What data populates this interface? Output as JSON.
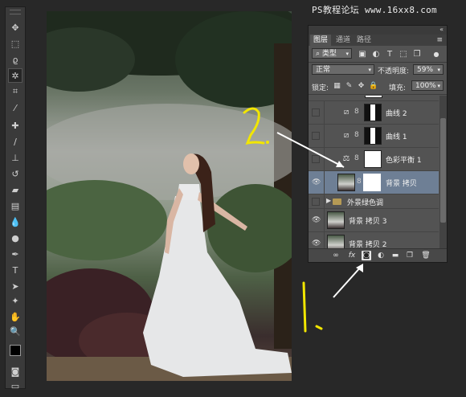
{
  "watermark": "PS教程论坛 www.16xx8.com",
  "toolbar": {
    "tools": [
      "move-tool",
      "marquee-tool",
      "lasso-tool",
      "magic-wand-tool",
      "crop-tool",
      "eyedropper-tool",
      "healing-brush-tool",
      "brush-tool",
      "clone-stamp-tool",
      "history-brush-tool",
      "eraser-tool",
      "gradient-tool",
      "blur-tool",
      "dodge-tool",
      "pen-tool",
      "type-tool",
      "path-selection-tool",
      "shape-tool",
      "hand-tool",
      "zoom-tool"
    ],
    "active_tool": "magic-wand-tool",
    "foreground_color": "#000000",
    "background_color": "#ffffff"
  },
  "panel": {
    "tabs": [
      "图层",
      "通道",
      "路径"
    ],
    "active_tab": "图层",
    "filter_kind": "类型",
    "blend_mode": "正常",
    "opacity_label": "不透明度:",
    "opacity_value": "59%",
    "lock_label": "锁定:",
    "fill_label": "填充:",
    "fill_value": "100%",
    "layers": [
      {
        "name": "曲线 2",
        "type": "curves",
        "visible": false,
        "selected": false
      },
      {
        "name": "曲线 1",
        "type": "curves",
        "visible": false,
        "selected": false
      },
      {
        "name": "色彩平衡 1",
        "type": "color-balance",
        "visible": false,
        "selected": false
      },
      {
        "name": "背景 拷贝",
        "type": "photo-mask",
        "visible": true,
        "selected": true
      },
      {
        "name": "外景绿色调",
        "type": "group",
        "visible": false,
        "selected": false
      },
      {
        "name": "背景 拷贝 3",
        "type": "photo",
        "visible": true,
        "selected": false
      },
      {
        "name": "背景 拷贝 2",
        "type": "photo",
        "visible": true,
        "selected": false
      }
    ]
  },
  "annotations": {
    "number_2": "2",
    "number_1": "1",
    "annotation_color": "#f2e600",
    "arrow_color": "#ffffff"
  }
}
